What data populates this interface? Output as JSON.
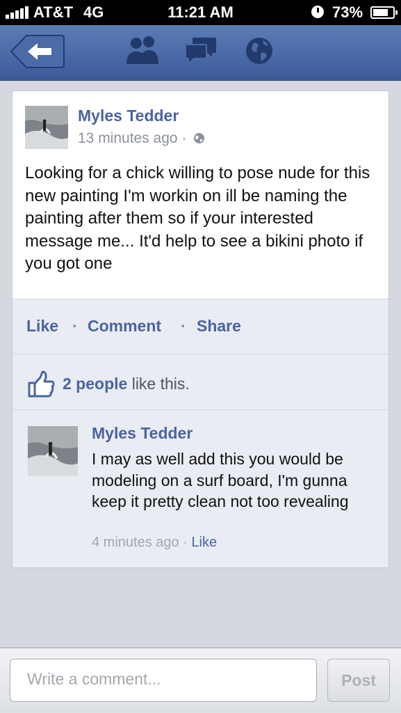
{
  "status_bar": {
    "carrier": "AT&T",
    "network": "4G",
    "time": "11:21 AM",
    "battery": "73%"
  },
  "nav": {
    "icons": [
      "back-arrow-icon",
      "friends-icon",
      "messages-icon",
      "globe-icon"
    ],
    "bar_color": "#3b5b9a"
  },
  "post": {
    "author": "Myles Tedder",
    "time": "13 minutes ago",
    "meta_separator": "·",
    "text": "Looking for a chick willing to pose nude for this new painting I'm workin on ill be naming the painting after them so if your interested message me... It'd help to see a bikini photo if you got one",
    "actions": {
      "like": "Like",
      "comment": "Comment",
      "share": "Share",
      "separator": "·"
    },
    "likes": {
      "count": "2 people",
      "suffix": "like this."
    }
  },
  "comment": {
    "author": "Myles Tedder",
    "text": "I may as well add this you would be modeling on a surf board, I'm gunna keep it pretty clean not too revealing",
    "time": "4 minutes ago",
    "separator": "·",
    "like": "Like"
  },
  "composer": {
    "placeholder": "Write a comment...",
    "post_label": "Post"
  },
  "colors": {
    "link": "#4b64a0",
    "background": "#d5d8de"
  }
}
